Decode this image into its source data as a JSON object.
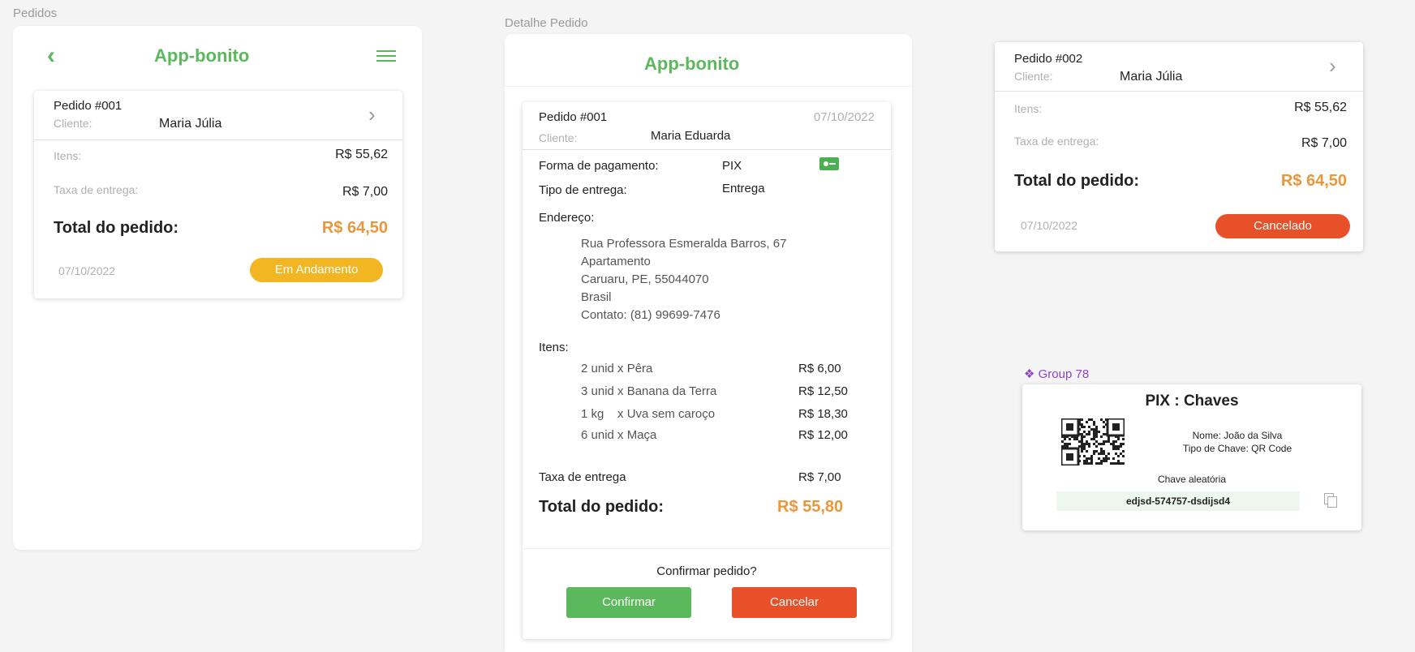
{
  "frames": {
    "pedidos_label": "Pedidos",
    "detalhe_label": "Detalhe Pedido",
    "group_label": "Group 78"
  },
  "app": {
    "title": "App-bonito",
    "back_icon": "chevron-left-icon",
    "menu_icon": "hamburger-menu-icon"
  },
  "order_card_1": {
    "order": "Pedido #001",
    "client_label": "Cliente:",
    "client_name": "Maria Júlia",
    "items_label": "Itens:",
    "items_value": "R$ 55,62",
    "delivery_label": "Taxa de entrega:",
    "delivery_value": "R$ 7,00",
    "total_label": "Total do pedido:",
    "total_value": "R$ 64,50",
    "date": "07/10/2022",
    "status": "Em Andamento",
    "status_color": "#f2b623"
  },
  "detail": {
    "order": "Pedido #001",
    "date": "07/10/2022",
    "client_label": "Cliente:",
    "client_name": "Maria Eduarda",
    "payment_label": "Forma de pagamento:",
    "payment_value": "PIX",
    "delivery_type_label": "Tipo de entrega:",
    "delivery_type_value": "Entrega",
    "address_label": "Endereço:",
    "address_lines": [
      "Rua Professora Esmeralda Barros, 67",
      "Apartamento",
      "Caruaru, PE, 55044070",
      "Brasil",
      "Contato: (81) 99699-7476"
    ],
    "items_label": "Itens:",
    "items": [
      {
        "desc": "2 unid x Pêra",
        "price": "R$ 6,00"
      },
      {
        "desc": "3 unid x Banana da Terra",
        "price": "R$ 12,50"
      },
      {
        "desc": "1 kg    x Uva sem caroço",
        "price": "R$ 18,30"
      },
      {
        "desc": "6 unid x Maça",
        "price": "R$ 12,00"
      }
    ],
    "fee_label": "Taxa de entrega",
    "fee_value": "R$ 7,00",
    "total_label": "Total do pedido:",
    "total_value": "R$ 55,80",
    "confirm_question": "Confirmar pedido?",
    "confirm_button": "Confirmar",
    "cancel_button": "Cancelar"
  },
  "order_card_2": {
    "order": "Pedido #002",
    "client_label": "Cliente:",
    "client_name": "Maria Júlia",
    "items_label": "Itens:",
    "items_value": "R$ 55,62",
    "delivery_label": "Taxa de entrega:",
    "delivery_value": "R$ 7,00",
    "total_label": "Total do pedido:",
    "total_value": "R$ 64,50",
    "date": "07/10/2022",
    "status": "Cancelado",
    "status_color": "#e8502a"
  },
  "pix": {
    "title": "PIX : Chaves",
    "name": "Nome: João da Silva",
    "key_type": "Tipo de Chave: QR Code",
    "random_label": "Chave aleatória",
    "key": "edjsd-574757-dsdijsd4"
  },
  "colors": {
    "green": "#5cb85c",
    "orange": "#e8973a",
    "confirm": "#5cb85c",
    "cancel": "#e8502a"
  }
}
